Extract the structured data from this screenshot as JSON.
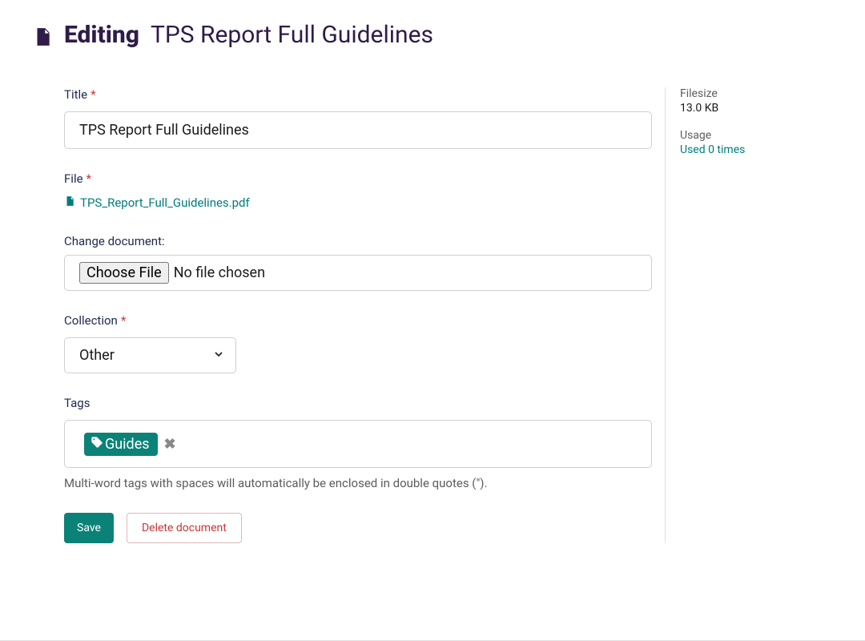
{
  "header": {
    "prefix": "Editing",
    "title": "TPS Report Full Guidelines"
  },
  "fields": {
    "title": {
      "label": "Title",
      "value": "TPS Report Full Guidelines"
    },
    "file": {
      "label": "File",
      "filename": "TPS_Report_Full_Guidelines.pdf",
      "change_label": "Change document:",
      "choose_button": "Choose File",
      "no_file_text": "No file chosen"
    },
    "collection": {
      "label": "Collection",
      "value": "Other"
    },
    "tags": {
      "label": "Tags",
      "items": [
        "Guides"
      ],
      "help": "Multi-word tags with spaces will automatically be enclosed in double quotes (\")."
    }
  },
  "actions": {
    "save": "Save",
    "delete": "Delete document"
  },
  "sidebar": {
    "filesize_label": "Filesize",
    "filesize_value": "13.0 KB",
    "usage_label": "Usage",
    "usage_value": "Used 0 times"
  }
}
